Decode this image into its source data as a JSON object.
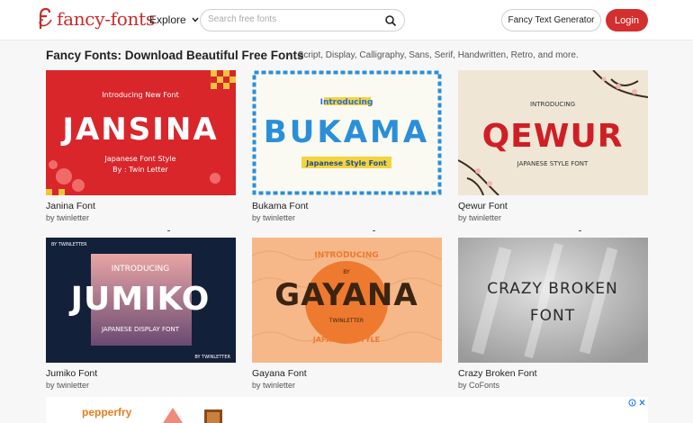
{
  "brand": {
    "name": "fancy-fonts",
    "color": "#c92a2a"
  },
  "nav": {
    "explore_label": "Explore"
  },
  "search": {
    "placeholder": "Search free fonts"
  },
  "buttons": {
    "generator_label": "Fancy Text Generator",
    "login_label": "Login"
  },
  "page": {
    "title": "Fancy Fonts: Download Beautiful Free Fonts",
    "separator": "-",
    "subtitle": "Script, Display, Calligraphy, Sans, Serif, Handwritten, Retro, and more."
  },
  "fonts": [
    {
      "name": "Janina Font",
      "author": "by twinletter",
      "preview": {
        "intro": "Introducing New Font",
        "title": "JANSINA",
        "line1": "Japanese Font Style",
        "line2": "By : Twin Letter",
        "bg": "#d9262b"
      }
    },
    {
      "name": "Bukama Font",
      "author": "by twinletter",
      "preview": {
        "intro": "Introducing",
        "title": "BUKAMA",
        "line1": "Japanese Style Font",
        "bg": "#fbfaf2"
      }
    },
    {
      "name": "Qewur Font",
      "author": "by twinletter",
      "preview": {
        "intro": "INTRODUCING",
        "title": "QEWUR",
        "line1": "JAPANESE STYLE FONT",
        "bg": "#efe6d6"
      }
    },
    {
      "name": "Jumiko Font",
      "author": "by twinletter",
      "preview": {
        "tag": "BY TWINLETTER",
        "intro": "INTRODUCING",
        "title": "JUMIKO",
        "line1": "JAPANESE DISPLAY FONT",
        "tag2": "BY TWINLETTER",
        "bg": "#13203a"
      }
    },
    {
      "name": "Gayana Font",
      "author": "by twinletter",
      "preview": {
        "intro": "INTRODUCING",
        "by": "BY",
        "title": "GAYANA",
        "maker": "TWINLETTER",
        "line1": "JAPANESE STYLE",
        "bg": "#f6b889"
      }
    },
    {
      "name": "Crazy Broken Font",
      "author": "by CoFonts",
      "preview": {
        "title": "CRAZY BROKEN",
        "line1": "FONT",
        "bg": "#c9c9c9"
      }
    }
  ],
  "ad": {
    "text": "pepperfry"
  },
  "icons": [
    "logo-icon",
    "chevron-down-icon",
    "search-icon",
    "ad-info-icon",
    "ad-close-icon"
  ]
}
